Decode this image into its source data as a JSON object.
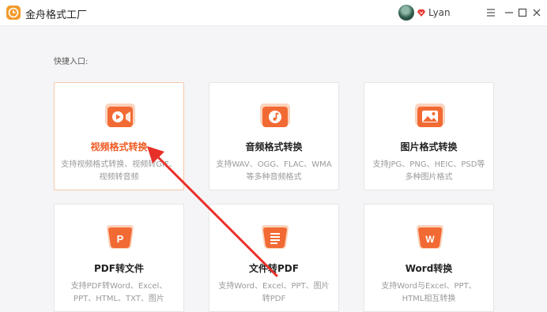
{
  "app": {
    "title": "金舟格式工厂"
  },
  "user": {
    "name": "Lyan"
  },
  "quick_entry_label": "快捷入口:",
  "cards": [
    {
      "title": "视频格式转换",
      "desc": "支持视频格式转换、视频转GIF、视频转音频",
      "icon": "video-icon"
    },
    {
      "title": "音频格式转换",
      "desc": "支持WAV、OGG、FLAC、WMA等多种音频格式",
      "icon": "music-icon"
    },
    {
      "title": "图片格式转换",
      "desc": "支持JPG、PNG、HEIC、PSD等多种图片格式",
      "icon": "image-icon"
    },
    {
      "title": "PDF转文件",
      "desc": "支持PDF转Word、Excel、PPT、HTML、TXT、图片",
      "icon": "pdf-icon"
    },
    {
      "title": "文件转PDF",
      "desc": "支持Word、Excel、PPT、图片转PDF",
      "icon": "document-icon"
    },
    {
      "title": "Word转换",
      "desc": "支持Word与Excel、PPT、HTML相互转换",
      "icon": "word-icon"
    }
  ],
  "colors": {
    "accent": "#ef5a22",
    "icon_gradient_start": "#ff9a5a",
    "icon_gradient_end": "#f0572a",
    "annotation_arrow": "#e8302a"
  }
}
